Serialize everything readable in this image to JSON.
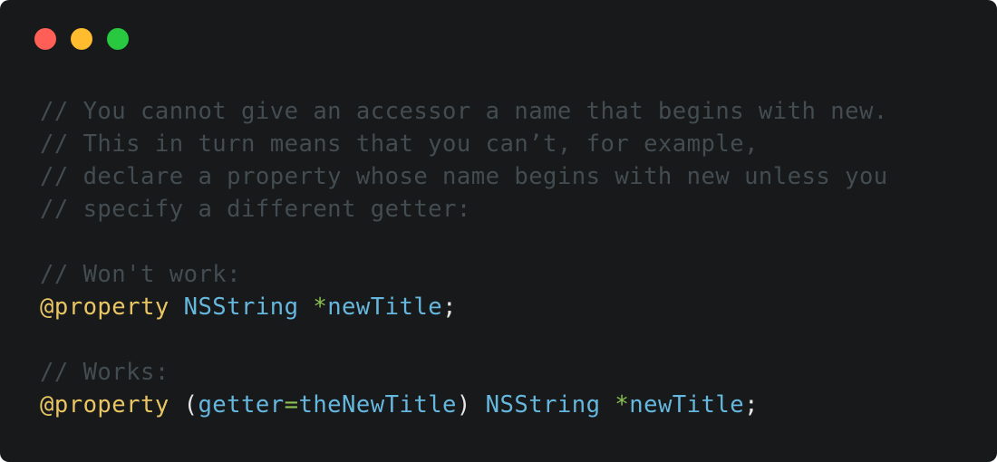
{
  "window": {
    "controls": {
      "close_color": "#ff5f57",
      "minimize_color": "#febc2e",
      "zoom_color": "#28c840"
    }
  },
  "code": {
    "comment_lines": [
      "// You cannot give an accessor a name that begins with new.",
      "// This in turn means that you can’t, for example,",
      "// declare a property whose name begins with new unless you",
      "// specify a different getter:"
    ],
    "wont_work_comment": "// Won't work:",
    "line1": {
      "keyword": "@property",
      "type": "NSString",
      "star": "*",
      "name": "newTitle",
      "semicolon": ";"
    },
    "works_comment": "// Works:",
    "line2": {
      "keyword": "@property",
      "open_paren": "(",
      "getter": "getter",
      "equals": "=",
      "getter_value": "theNewTitle",
      "close_paren": ")",
      "type": "NSString",
      "star": "*",
      "name": "newTitle",
      "semicolon": ";"
    }
  },
  "colors": {
    "background": "#17191b",
    "comment": "#434c51",
    "keyword": "#e9c663",
    "type": "#66b7de",
    "operator": "#8cc152",
    "text": "#e6e6e6"
  }
}
